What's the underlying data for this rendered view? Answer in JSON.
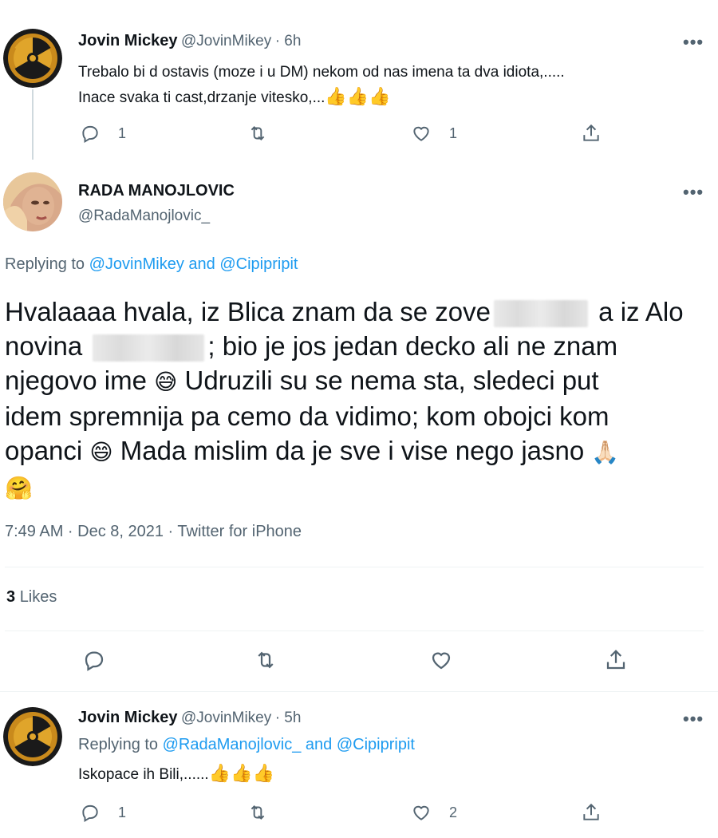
{
  "tweet1": {
    "name": "Jovin Mickey",
    "handle": "@JovinMikey",
    "time": "· 6h",
    "more": "•••",
    "line1": "Trebalo bi d ostavis (moze i u DM) nekom od nas imena ta dva idiota,.....",
    "line2": "Inace svaka ti cast,drzanje vitesko,...",
    "line2_emoji": "👍👍👍",
    "reply_count": "1",
    "like_count": "1"
  },
  "main": {
    "name": "RADA MANOJLOVIC",
    "handle": "@RadaManojlovic_",
    "more": "•••",
    "replying_prefix": "Replying to",
    "replying_user1": "@JovinMikey",
    "replying_and": "and",
    "replying_user2": "@Cipipripit",
    "t1": "Hvalaaaa hvala, iz Blica znam da se zove",
    "t2": "a iz Alo",
    "t3": "novina",
    "t4": "; bio je jos jedan decko ali ne znam",
    "t5": "njegovo ime",
    "e1": "😅",
    "t6": "Udruzili su se nema sta, sledeci put",
    "t7": "idem spremnija pa cemo da vidimo; kom obojci kom",
    "t8": "opanci",
    "e2": "😄",
    "t9": "Mada mislim da je sve i vise nego jasno",
    "e3": "🙏🏻",
    "e4": "🤗",
    "meta": "7:49 AM · Dec 8, 2021 · Twitter for iPhone",
    "likes_count": "3",
    "likes_label": "Likes"
  },
  "tweet3": {
    "name": "Jovin Mickey",
    "handle": "@JovinMikey",
    "time": "· 5h",
    "more": "•••",
    "replying_prefix": "Replying to",
    "replying_user1": "@RadaManojlovic_",
    "replying_and": "and",
    "replying_user2": "@Cipipripit",
    "text": "Iskopace ih Bili,......",
    "text_emoji": "👍👍👍",
    "reply_count": "1",
    "like_count": "2"
  },
  "icons": [
    "reply-icon",
    "retweet-icon",
    "like-icon",
    "share-icon",
    "more-icon",
    "radiation-avatar"
  ]
}
